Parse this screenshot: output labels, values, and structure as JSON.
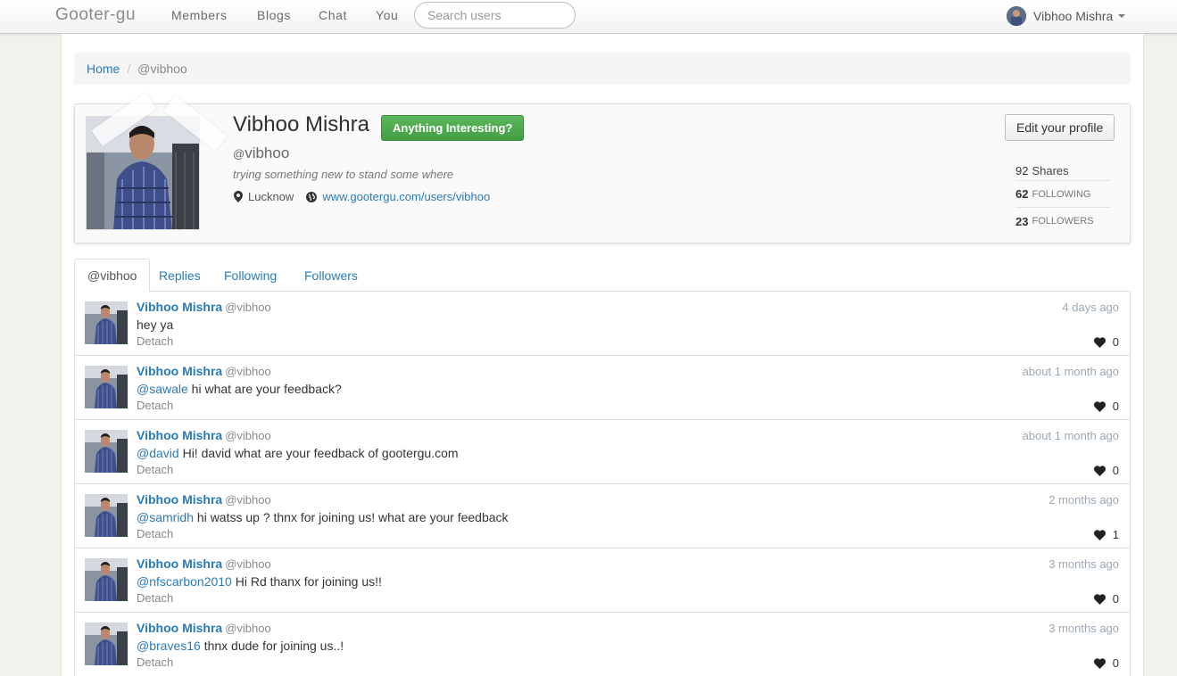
{
  "navbar": {
    "brand": "Gooter-gu",
    "items": [
      {
        "label": "Members"
      },
      {
        "label": "Blogs"
      },
      {
        "label": "Chat"
      },
      {
        "label": "You"
      }
    ],
    "search_placeholder": "Search users",
    "user_name": "Vibhoo Mishra"
  },
  "breadcrumb": {
    "home": "Home",
    "sep": "/",
    "current": "@vibhoo"
  },
  "profile": {
    "name": "Vibhoo Mishra",
    "cta": "Anything Interesting?",
    "handle_at": "@",
    "handle": "vibhoo",
    "bio": "trying something new to stand some where",
    "location": "Lucknow",
    "url": "www.gootergu.com/users/vibhoo",
    "edit_label": "Edit your profile",
    "stats": {
      "shares_count": "92",
      "shares_label": "Shares",
      "following_count": "62",
      "following_label": "FOLLOWING",
      "followers_count": "23",
      "followers_label": "FOLLOWERS"
    }
  },
  "tabs": [
    {
      "label": "@vibhoo"
    },
    {
      "label": "Replies"
    },
    {
      "label": "Following"
    },
    {
      "label": "Followers"
    }
  ],
  "posts": [
    {
      "author": "Vibhoo Mishra",
      "handle": "@vibhoo",
      "mention": "",
      "text": "hey ya",
      "detach": "Detach",
      "time": "4 days ago",
      "likes": "0"
    },
    {
      "author": "Vibhoo Mishra",
      "handle": "@vibhoo",
      "mention": "@sawale",
      "text": " hi what are your feedback?",
      "detach": "Detach",
      "time": "about 1 month ago",
      "likes": "0"
    },
    {
      "author": "Vibhoo Mishra",
      "handle": "@vibhoo",
      "mention": "@david",
      "text": " Hi! david what are your feedback of gootergu.com",
      "detach": "Detach",
      "time": "about 1 month ago",
      "likes": "0"
    },
    {
      "author": "Vibhoo Mishra",
      "handle": "@vibhoo",
      "mention": "@samridh",
      "text": " hi watss up ? thnx for joining us! what are your feedback",
      "detach": "Detach",
      "time": "2 months ago",
      "likes": "1"
    },
    {
      "author": "Vibhoo Mishra",
      "handle": "@vibhoo",
      "mention": "@nfscarbon2010",
      "text": " Hi Rd thanx for joining us!!",
      "detach": "Detach",
      "time": "3 months ago",
      "likes": "0"
    },
    {
      "author": "Vibhoo Mishra",
      "handle": "@vibhoo",
      "mention": "@braves16",
      "text": " thnx dude for joining us..!",
      "detach": "Detach",
      "time": "3 months ago",
      "likes": "0"
    }
  ]
}
